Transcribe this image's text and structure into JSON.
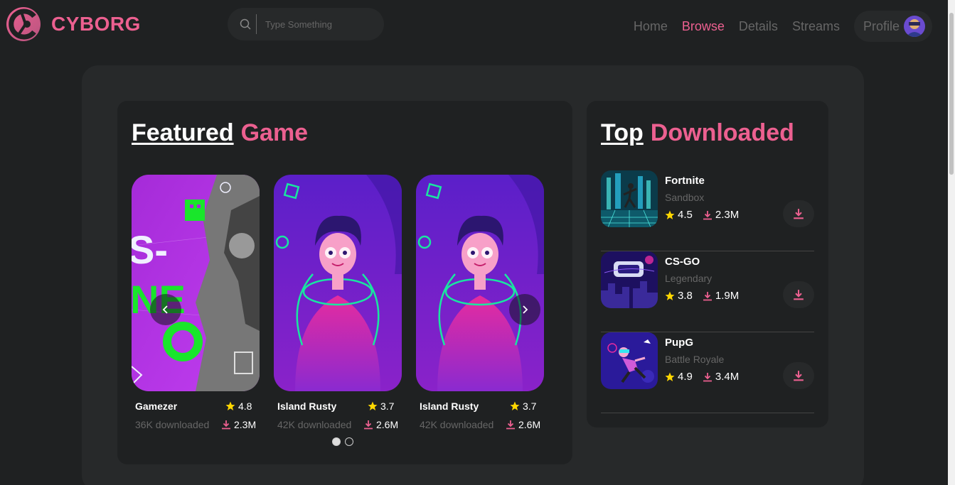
{
  "header": {
    "brand": "CYBORG",
    "search": {
      "placeholder": "Type Something",
      "value": ""
    },
    "nav": [
      "Home",
      "Browse",
      "Details",
      "Streams"
    ],
    "active_nav": "Browse",
    "profile_label": "Profile"
  },
  "colors": {
    "accent": "#ec6090",
    "bg": "#1f2122",
    "panel": "#27292a",
    "muted": "#666666",
    "star": "#ffd700"
  },
  "featured": {
    "title_white": "Featured",
    "title_pink": "Game",
    "games": [
      {
        "title": "Gamezer",
        "rating": "4.8",
        "downloaded": "36K downloaded",
        "downloads": "2.3M"
      },
      {
        "title": "Island Rusty",
        "rating": "3.7",
        "downloaded": "42K downloaded",
        "downloads": "2.6M"
      },
      {
        "title": "Island Rusty",
        "rating": "3.7",
        "downloaded": "42K downloaded",
        "downloads": "2.6M"
      }
    ],
    "pages": 2,
    "current_page": 1
  },
  "top_downloaded": {
    "title_white": "Top",
    "title_pink": "Downloaded",
    "items": [
      {
        "name": "Fortnite",
        "genre": "Sandbox",
        "rating": "4.5",
        "downloads": "2.3M"
      },
      {
        "name": "CS-GO",
        "genre": "Legendary",
        "rating": "3.8",
        "downloads": "1.9M"
      },
      {
        "name": "PupG",
        "genre": "Battle Royale",
        "rating": "4.9",
        "downloads": "3.4M"
      }
    ]
  },
  "icons": [
    "logo-icon",
    "search-icon",
    "avatar",
    "star-icon",
    "download-icon",
    "chevron-left-icon",
    "chevron-right-icon"
  ]
}
